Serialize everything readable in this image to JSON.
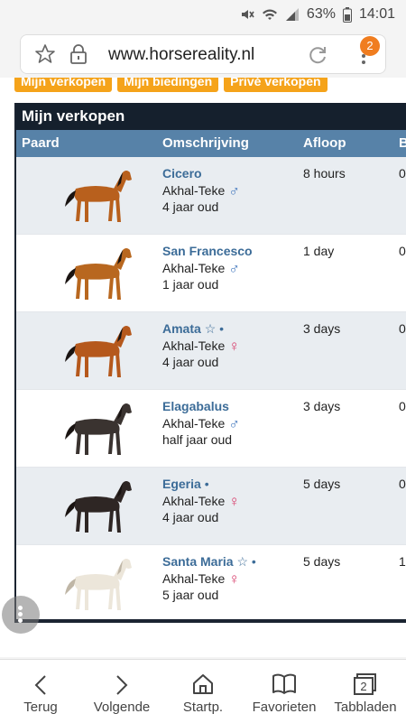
{
  "status": {
    "battery": "63%",
    "time": "14:01"
  },
  "browser": {
    "url": "www.horsereality.nl",
    "tab_count": "2"
  },
  "tabs": [
    "Mijn verkopen",
    "Mijn biedingen",
    "Privé verkopen"
  ],
  "panel": {
    "title": "Mijn verkopen"
  },
  "columns": {
    "horse": "Paard",
    "description": "Omschrijving",
    "expiry": "Afloop",
    "partial": "B"
  },
  "rows": [
    {
      "name": "Cicero",
      "extra": "",
      "breed": "Akhal-Teke",
      "sex": "♂",
      "age": "4 jaar oud",
      "time": "8 hours",
      "edge": "0"
    },
    {
      "name": "San Francesco",
      "extra": "",
      "breed": "Akhal-Teke",
      "sex": "♂",
      "age": "1 jaar oud",
      "time": "1 day",
      "edge": "0"
    },
    {
      "name": "Amata",
      "extra": "☆ •",
      "breed": "Akhal-Teke",
      "sex": "♀",
      "age": "4 jaar oud",
      "time": "3 days",
      "edge": "0"
    },
    {
      "name": "Elagabalus",
      "extra": "",
      "breed": "Akhal-Teke",
      "sex": "♂",
      "age": "half jaar oud",
      "time": "3 days",
      "edge": "0"
    },
    {
      "name": "Egeria",
      "extra": "•",
      "breed": "Akhal-Teke",
      "sex": "♀",
      "age": "4 jaar oud",
      "time": "5 days",
      "edge": "0"
    },
    {
      "name": "Santa Maria",
      "extra": "☆ •",
      "breed": "Akhal-Teke",
      "sex": "♀",
      "age": "5 jaar oud",
      "time": "5 days",
      "edge": "1"
    }
  ],
  "horse_colors": [
    "#b8601d",
    "#b8671f",
    "#b5581c",
    "#3a3330",
    "#2e2624",
    "#ece6da"
  ],
  "nav": [
    {
      "label": "Terug",
      "icon": "back-icon"
    },
    {
      "label": "Volgende",
      "icon": "forward-icon"
    },
    {
      "label": "Startp.",
      "icon": "home-icon"
    },
    {
      "label": "Favorieten",
      "icon": "bookmarks-icon"
    },
    {
      "label": "Tabbladen",
      "icon": "tabs-icon"
    }
  ]
}
